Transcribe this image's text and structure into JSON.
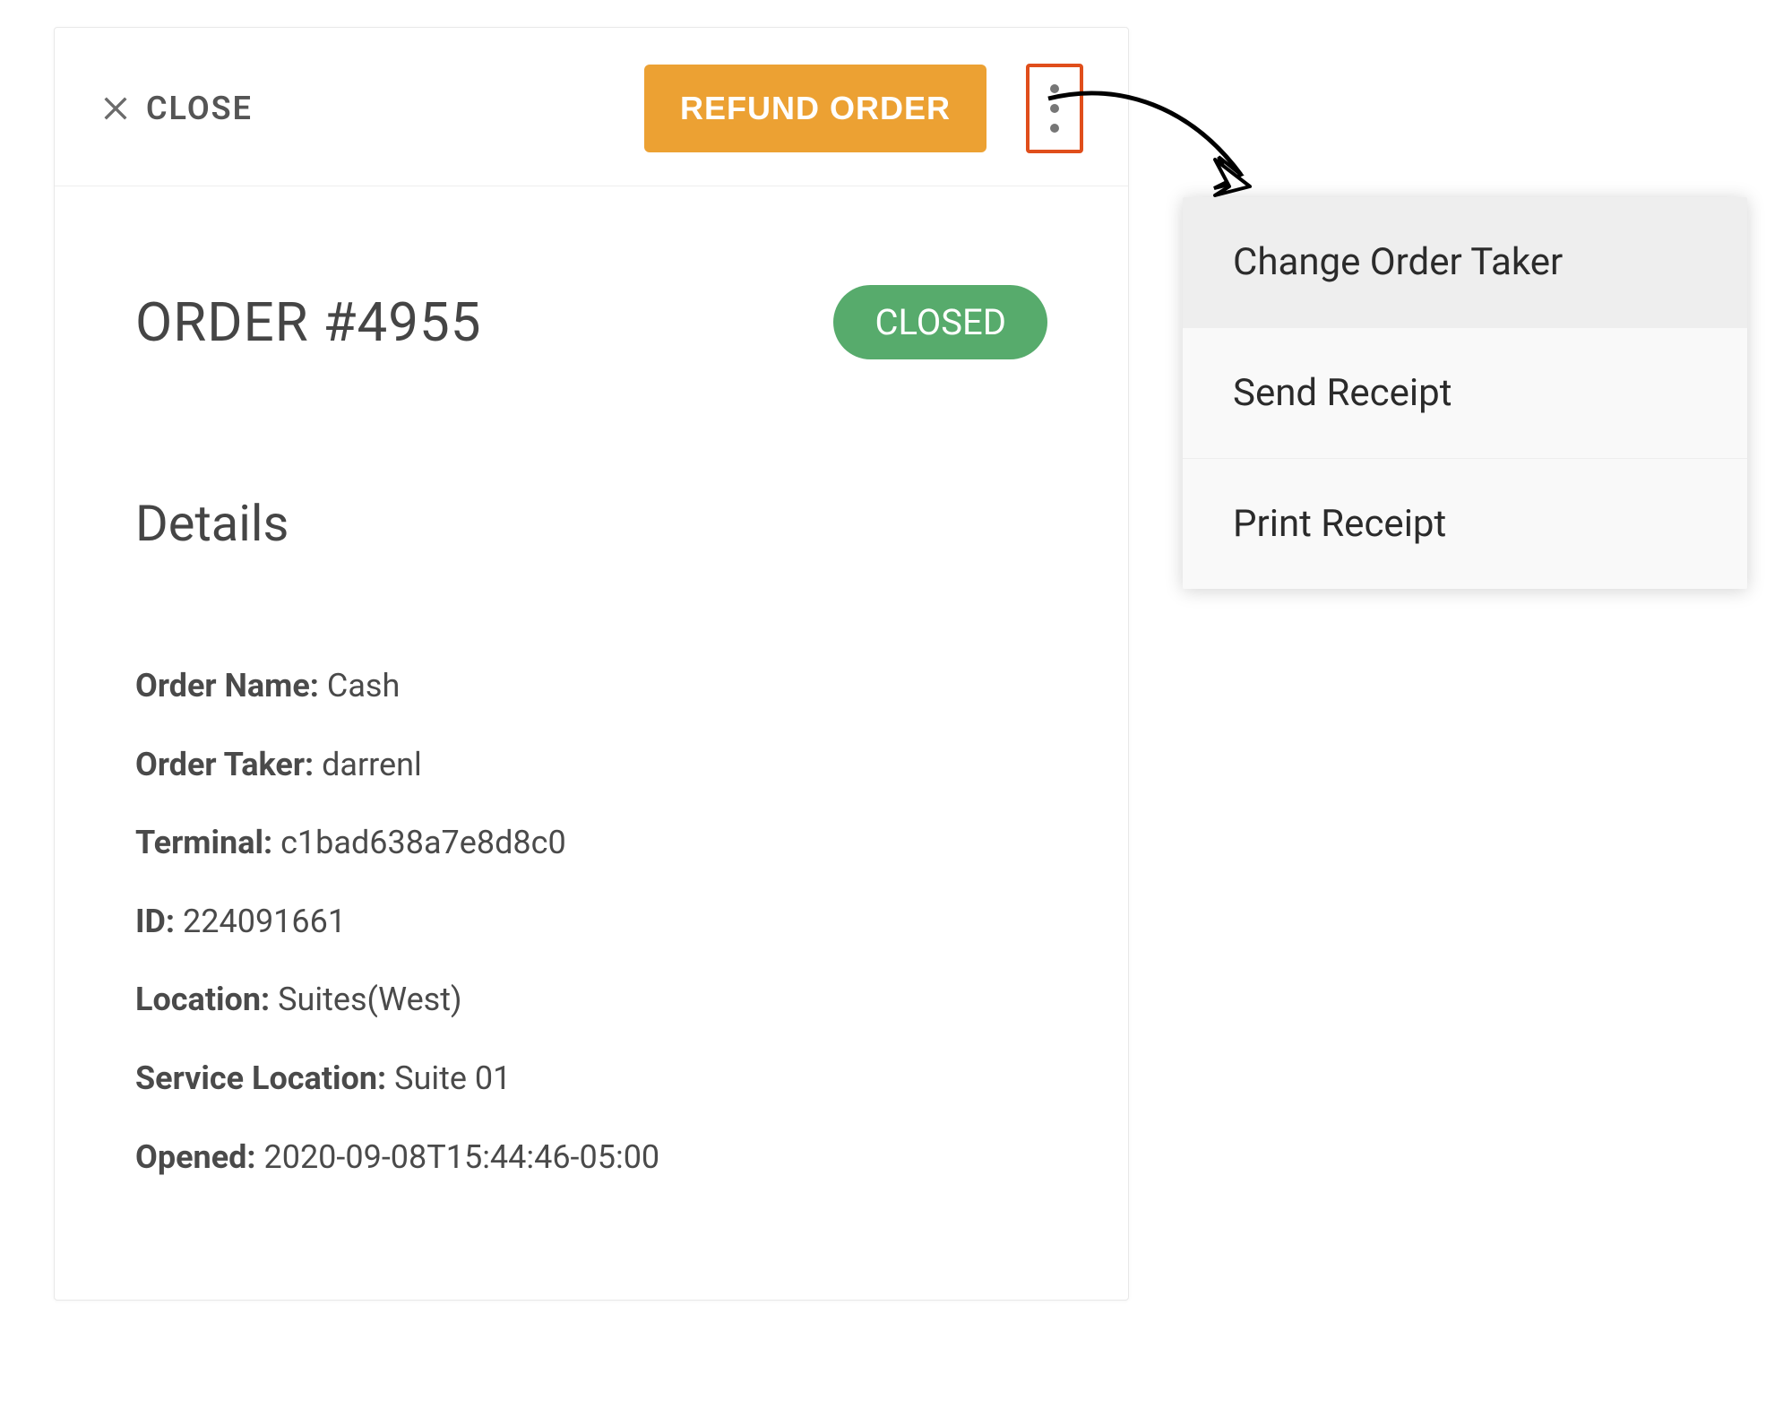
{
  "header": {
    "close_label": "CLOSE",
    "refund_label": "REFUND ORDER"
  },
  "order": {
    "title": "ORDER #4955",
    "status": "CLOSED"
  },
  "details": {
    "heading": "Details",
    "fields": [
      {
        "label": "Order Name:",
        "value": "Cash"
      },
      {
        "label": "Order Taker:",
        "value": "darrenl"
      },
      {
        "label": "Terminal:",
        "value": "c1bad638a7e8d8c0"
      },
      {
        "label": "ID:",
        "value": "224091661"
      },
      {
        "label": "Location:",
        "value": "Suites(West)"
      },
      {
        "label": "Service Location:",
        "value": "Suite 01"
      },
      {
        "label": "Opened:",
        "value": "2020-09-08T15:44:46-05:00"
      }
    ]
  },
  "menu": {
    "items": [
      "Change Order Taker",
      "Send Receipt",
      "Print Receipt"
    ]
  }
}
